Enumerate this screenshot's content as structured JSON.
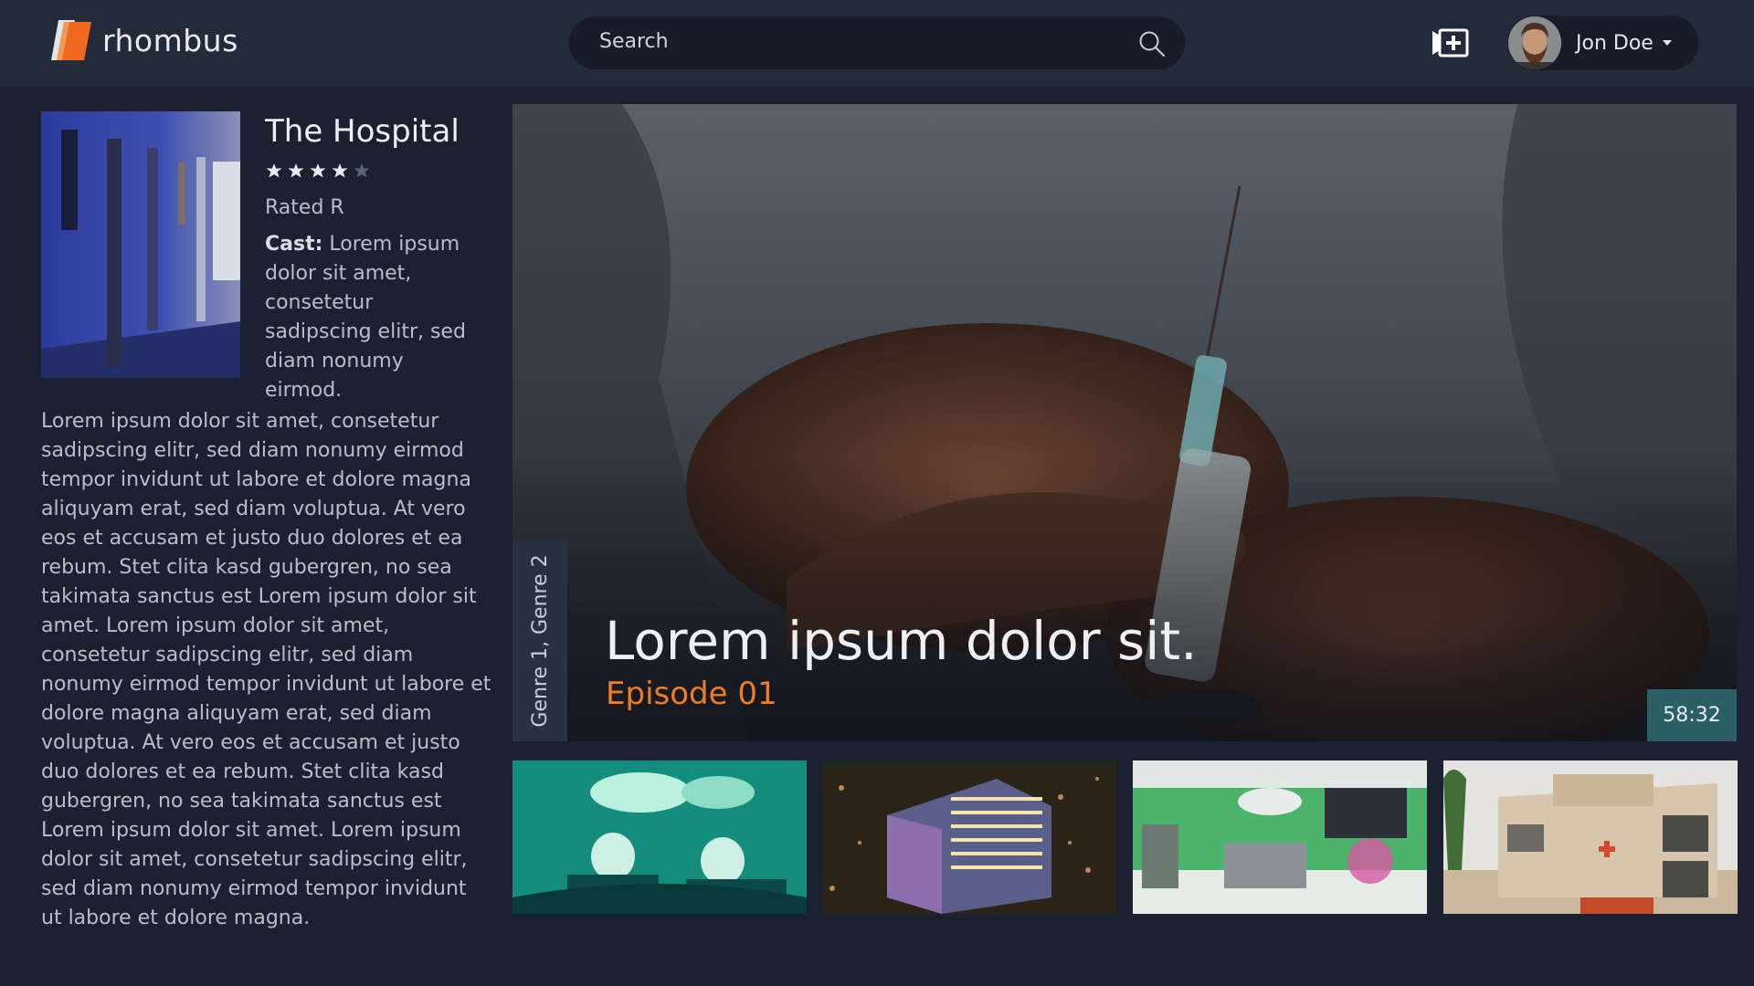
{
  "app": {
    "name": "rhombus"
  },
  "search": {
    "placeholder": "Search"
  },
  "user": {
    "name": "Jon Doe"
  },
  "show": {
    "title": "The Hospital",
    "stars_filled": 4,
    "stars_total": 5,
    "rating": "Rated R",
    "cast_label": "Cast:",
    "cast_text": " Lorem ipsum dolor sit amet, consetetur sadipscing elitr, sed diam nonumy eirmod.",
    "description": "Lorem ipsum dolor sit amet, consetetur sadipscing elitr, sed diam nonumy eirmod tempor invidunt ut labore et dolore magna aliquyam erat, sed diam voluptua. At vero eos et accusam et justo duo dolores et ea rebum. Stet clita kasd gubergren, no sea takimata sanctus est Lorem ipsum dolor sit amet. Lorem ipsum dolor sit amet, consetetur sadipscing elitr, sed diam nonumy eirmod tempor invidunt ut labore et dolore magna aliquyam erat, sed diam voluptua. At vero eos et accusam et justo duo dolores et ea rebum. Stet clita kasd gubergren, no sea takimata sanctus est Lorem ipsum dolor sit amet. Lorem ipsum dolor sit amet, consetetur sadipscing elitr, sed diam nonumy eirmod tempor invidunt ut labore et dolore magna."
  },
  "hero": {
    "genres": "Genre 1, Genre 2",
    "title": "Lorem ipsum dolor sit.",
    "episode": "Episode 01",
    "duration": "58:32"
  },
  "thumbnails": [
    "operating-room-surgeons",
    "hospital-aerial-night",
    "operating-theatre-green",
    "lifeguard-station"
  ],
  "colors": {
    "accent": "#ef7d22",
    "teal": "#2b5f63",
    "background": "#1b2130",
    "header": "#232a39"
  },
  "icons": [
    "logo-icon",
    "search-icon",
    "add-to-playlist-icon",
    "caret-down-icon",
    "star-icon"
  ]
}
